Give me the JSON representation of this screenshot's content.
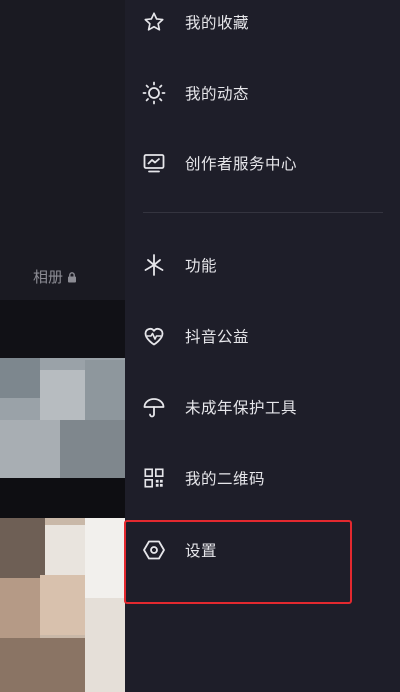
{
  "background": {
    "album_label": "相册",
    "lock_icon": "lock-icon"
  },
  "menu": {
    "items": [
      {
        "label": "我的收藏",
        "icon": "star-icon"
      },
      {
        "label": "我的动态",
        "icon": "sun-icon"
      },
      {
        "label": "创作者服务中心",
        "icon": "chart-monitor-icon"
      },
      {
        "label": "功能",
        "icon": "sparkle-icon"
      },
      {
        "label": "抖音公益",
        "icon": "heart-pulse-icon"
      },
      {
        "label": "未成年保护工具",
        "icon": "umbrella-icon"
      },
      {
        "label": "我的二维码",
        "icon": "qr-code-icon"
      },
      {
        "label": "设置",
        "icon": "gear-hexagon-icon"
      }
    ]
  },
  "colors": {
    "drawer_bg": "#1e1e29",
    "text": "#e6e6ea",
    "highlight_border": "#e3292f"
  }
}
